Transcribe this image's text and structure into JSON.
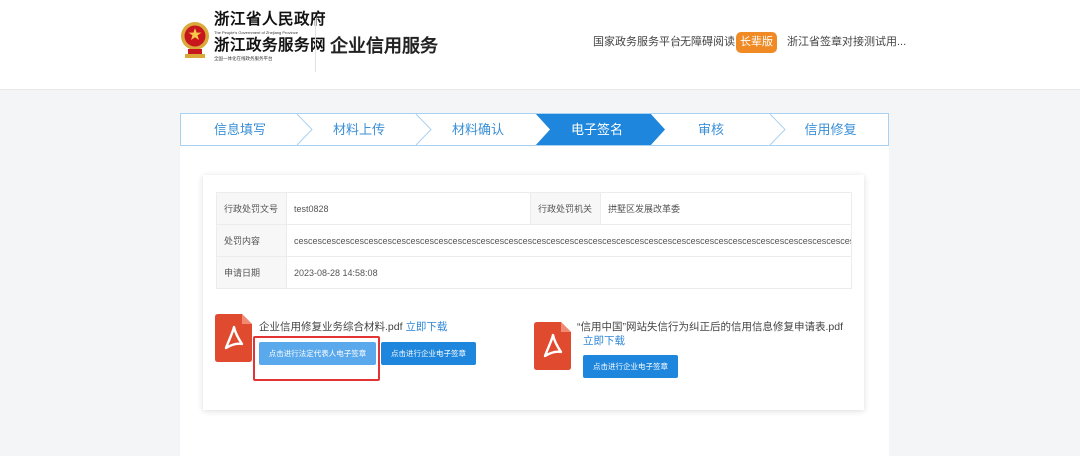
{
  "header": {
    "gov_name": "浙江省人民政府",
    "gov_name_en": "The People's Government of Zhejiang Province",
    "portal_name": "浙江政务服务网",
    "portal_slogan": "全国一体化在线政务服务平台",
    "service_title": "企业信用服务",
    "nav": {
      "national_platform": "国家政务服务平台",
      "accessibility": "无障碍阅读",
      "elder_mode": "长辈版",
      "user_name": "浙江省签章对接测试用..."
    }
  },
  "steps": [
    {
      "label": "信息填写",
      "active": false
    },
    {
      "label": "材料上传",
      "active": false
    },
    {
      "label": "材料确认",
      "active": false
    },
    {
      "label": "电子签名",
      "active": true
    },
    {
      "label": "审核",
      "active": false
    },
    {
      "label": "信用修复",
      "active": false
    }
  ],
  "info": {
    "doc_no_label": "行政处罚文号",
    "doc_no_value": "test0828",
    "authority_label": "行政处罚机关",
    "authority_value": "拱墅区发展改革委",
    "content_label": "处罚内容",
    "content_value": "cescescescescescescescescescescescescescescescescescescescescescescescescescescescescescescescescescescescescescescescescescescescescescescescesces.",
    "date_label": "申请日期",
    "date_value": "2023-08-28 14:58:08"
  },
  "files": [
    {
      "name": "企业信用修复业务综合材料.pdf",
      "download": "立即下载",
      "legal_sign_button": "点击进行法定代表人电子签章",
      "company_sign_button": "点击进行企业电子签章"
    },
    {
      "name": "“信用中国”网站失信行为纠正后的信用信息修复申请表.pdf",
      "download": "立即下载",
      "company_sign_button": "点击进行企业电子签章"
    }
  ],
  "colors": {
    "step_active": "#1e86dd",
    "step_text": "#3a8fd6",
    "elder_button": "#f08a24",
    "pdf_icon": "#e04a2f",
    "highlight_box": "#e23434"
  }
}
